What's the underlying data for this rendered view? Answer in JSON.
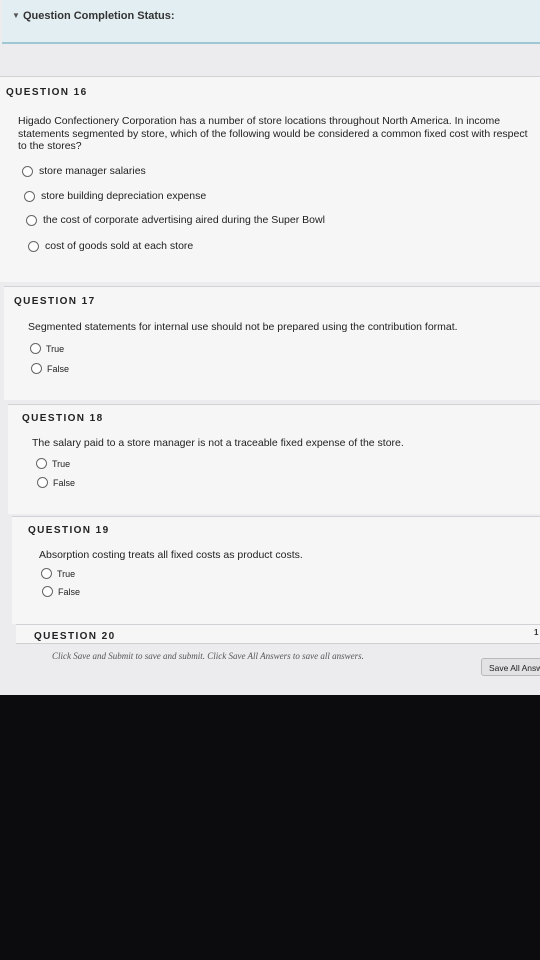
{
  "status": {
    "label": "Question Completion Status:"
  },
  "questions": [
    {
      "title": "QUESTION 16",
      "text": "Higado Confectionery Corporation has a number of store locations throughout North America. In income statements segmented by store, which of the following would be considered a common fixed cost with respect to the stores?",
      "options": [
        "store manager salaries",
        "store building depreciation expense",
        "the cost of corporate advertising aired during the Super Bowl",
        "cost of goods sold at each store"
      ]
    },
    {
      "title": "QUESTION 17",
      "text": "Segmented statements for internal use should not be prepared using the contribution format.",
      "options": [
        "True",
        "False"
      ]
    },
    {
      "title": "QUESTION 18",
      "text": "The salary paid to a store manager is not a traceable fixed expense of the store.",
      "options": [
        "True",
        "False"
      ]
    },
    {
      "title": "QUESTION 19",
      "text": "Absorption costing treats all fixed costs as product costs.",
      "options": [
        "True",
        "False"
      ]
    },
    {
      "title": "QUESTION 20"
    }
  ],
  "footer": {
    "note": "Click Save and Submit to save and submit. Click Save All Answers to save all answers.",
    "save_all": "Save All Answers",
    "page_indicator": "1"
  }
}
